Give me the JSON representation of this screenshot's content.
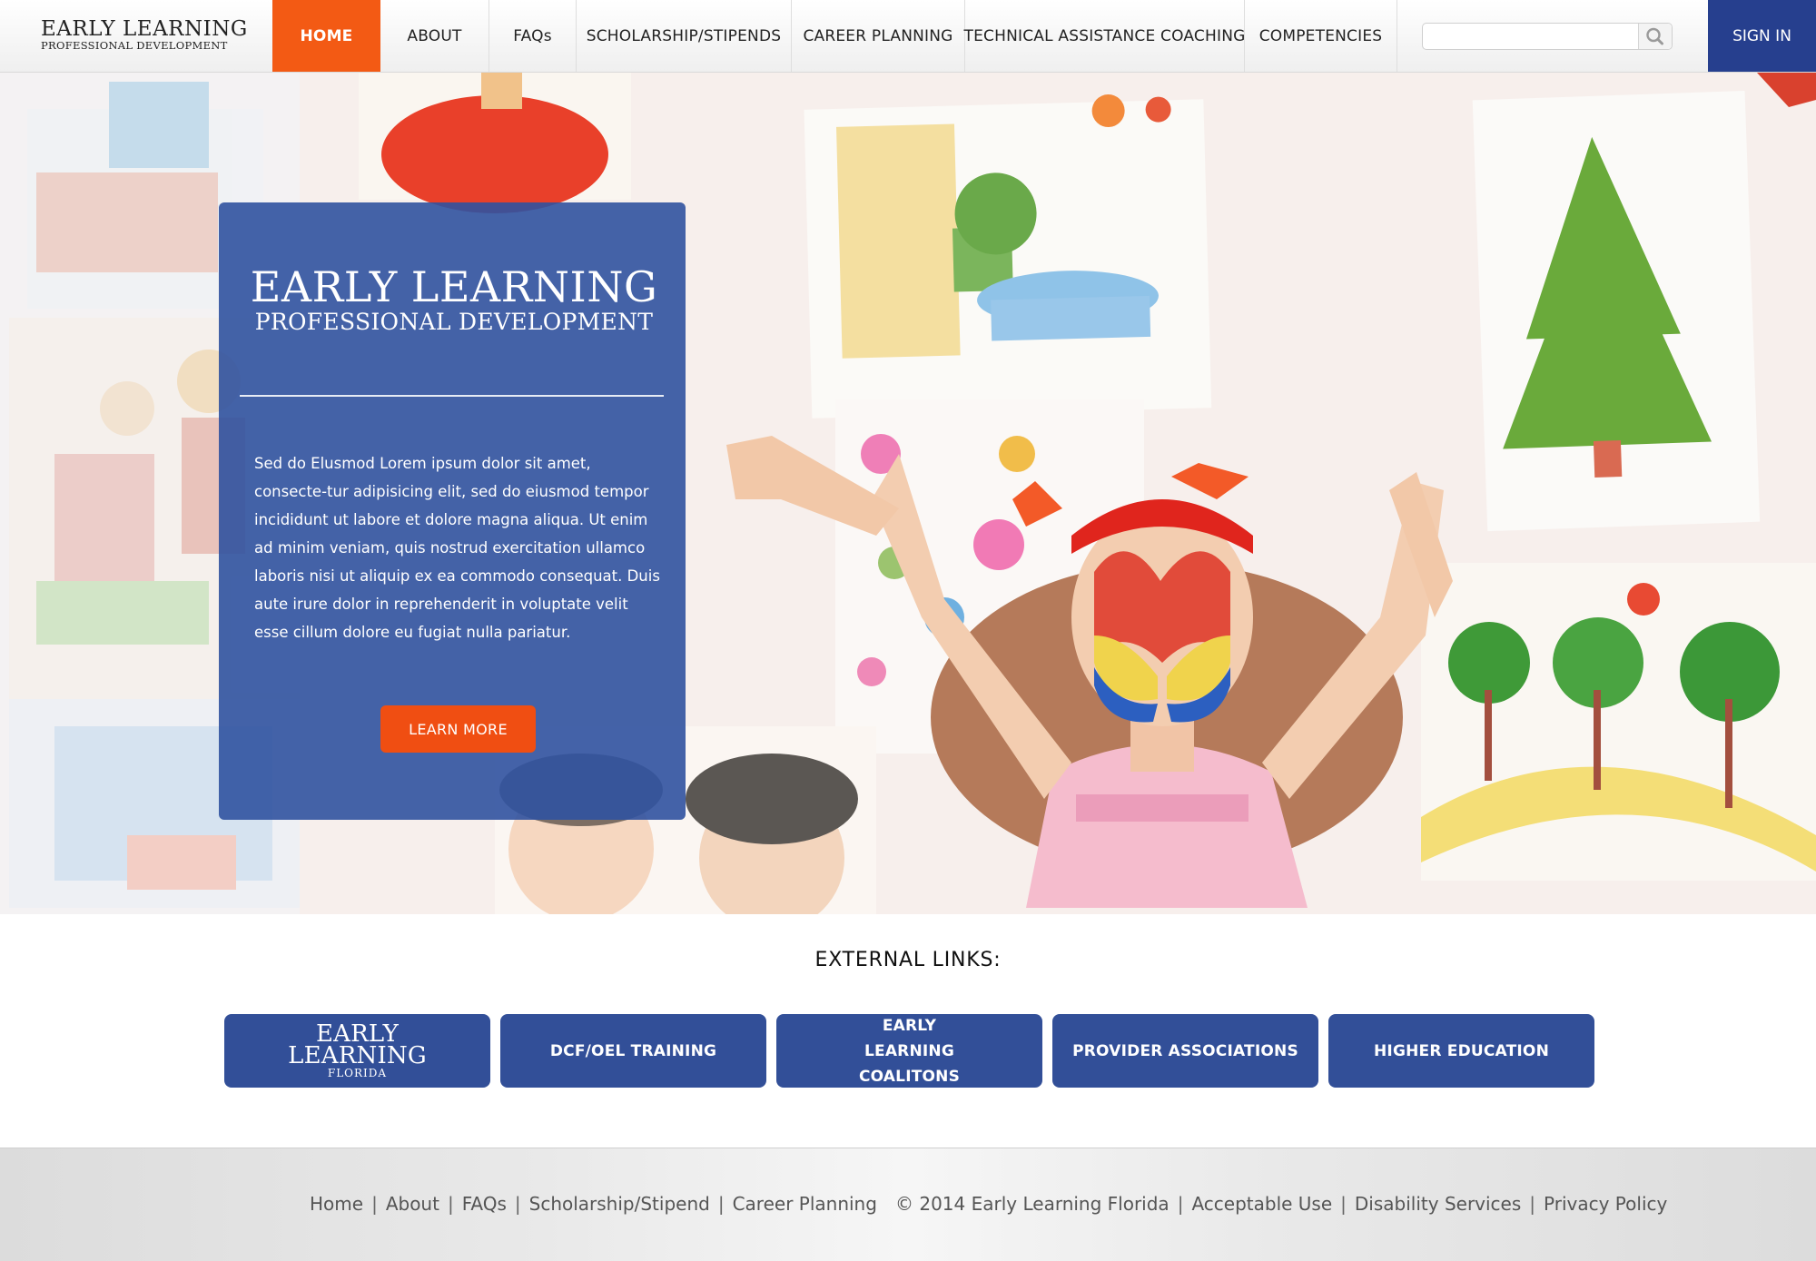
{
  "header": {
    "logo_line1": "EARLY LEARNING",
    "logo_line2": "PROFESSIONAL DEVELOPMENT",
    "nav": [
      {
        "label": "HOME"
      },
      {
        "label": "ABOUT"
      },
      {
        "label": "FAQs"
      },
      {
        "label": "SCHOLARSHIP/STIPENDS"
      },
      {
        "label": "CAREER PLANNING"
      },
      {
        "label": "TECHNICAL ASSISTANCE COACHING"
      },
      {
        "label": "COMPETENCIES"
      }
    ],
    "search_value": "",
    "sign_in": "SIGN IN"
  },
  "hero": {
    "title_line1": "EARLY LEARNING",
    "title_line2": "PROFESSIONAL DEVELOPMENT",
    "body": "Sed do Elusmod Lorem ipsum dolor sit amet, consecte-tur adipisicing elit, sed do eiusmod tempor incididunt ut labore et dolore magna aliqua. Ut enim ad minim veniam, quis nostrud exercitation ullamco laboris nisi ut aliquip ex ea commodo consequat. Duis aute irure dolor in reprehenderit in voluptate velit esse cillum dolore eu fugiat nulla pariatur.",
    "cta": "LEARN MORE"
  },
  "external": {
    "title": "EXTERNAL LINKS:",
    "logo_line1": "EARLY",
    "logo_line2": "LEARNING",
    "logo_line3": "FLORIDA",
    "links": [
      {
        "label": "DCF/OEL TRAINING"
      },
      {
        "label": "EARLY LEARNING COALITONS"
      },
      {
        "label": "PROVIDER ASSOCIATIONS"
      },
      {
        "label": "HIGHER EDUCATION"
      }
    ]
  },
  "footer": {
    "left_links": [
      "Home",
      "About",
      "FAQs",
      "Scholarship/Stipend",
      "Career Planning"
    ],
    "copyright": "© 2014 Early Learning Florida",
    "right_links": [
      "Acceptable Use",
      "Disability Services",
      "Privacy Policy"
    ],
    "separator": "|"
  },
  "colors": {
    "accent_orange": "#f35a14",
    "brand_blue": "#263f8e",
    "button_blue": "#324f98"
  },
  "icons": {
    "search": "search-icon"
  }
}
